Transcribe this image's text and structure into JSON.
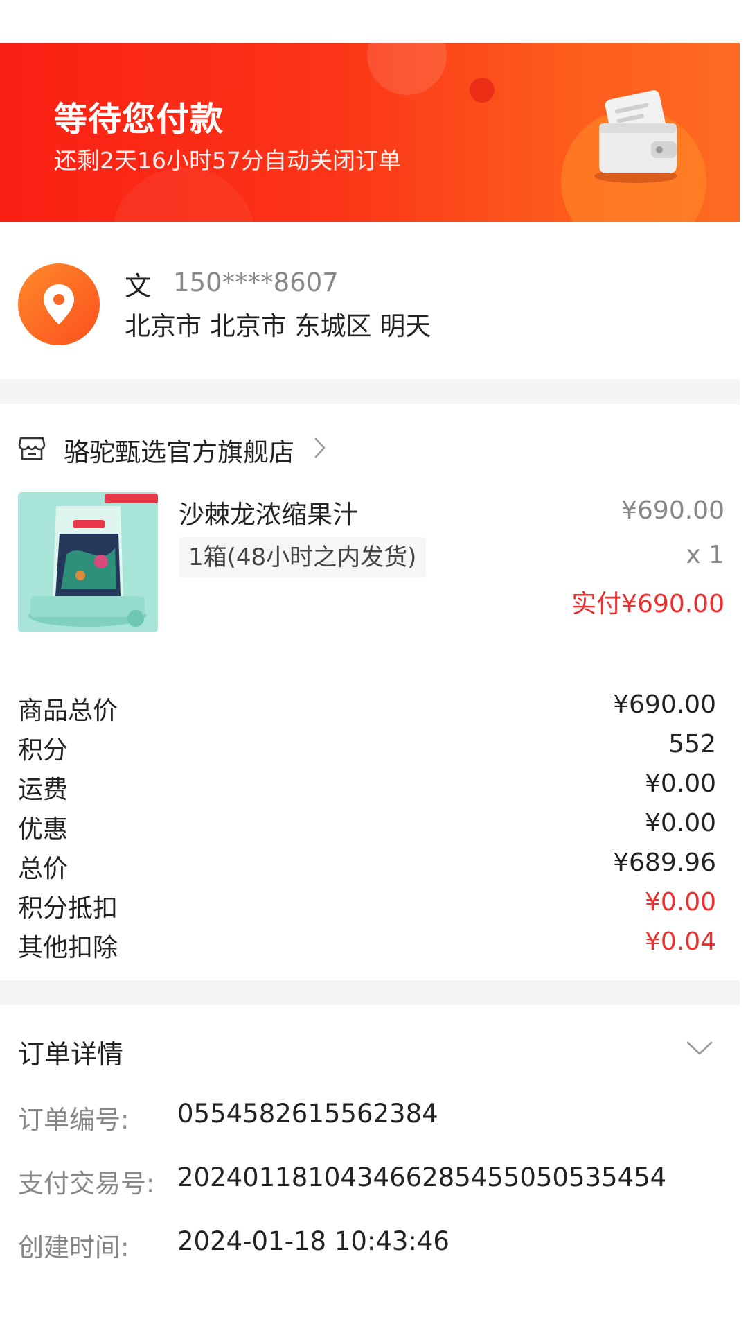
{
  "banner": {
    "title": "等待您付款",
    "subtitle": "还剩2天16小时57分自动关闭订单"
  },
  "address": {
    "name": "文",
    "phone": "150****8607",
    "line": "北京市 北京市 东城区 明天"
  },
  "shop": {
    "name": "骆驼甄选官方旗舰店"
  },
  "product": {
    "name": "沙棘龙浓缩果汁",
    "spec": "1箱(48小时之内发货)",
    "unit_price": "¥690.00",
    "quantity": "x 1",
    "paid": "实付¥690.00"
  },
  "summary": [
    {
      "label": "商品总价",
      "value": "¥690.00",
      "highlight": false
    },
    {
      "label": "积分",
      "value": "552",
      "highlight": false
    },
    {
      "label": "运费",
      "value": "¥0.00",
      "highlight": false
    },
    {
      "label": "优惠",
      "value": "¥0.00",
      "highlight": false
    },
    {
      "label": "总价",
      "value": "¥689.96",
      "highlight": false
    },
    {
      "label": "积分抵扣",
      "value": "¥0.00",
      "highlight": true
    },
    {
      "label": "其他扣除",
      "value": "¥0.04",
      "highlight": true
    }
  ],
  "order_detail": {
    "title": "订单详情",
    "rows": [
      {
        "label": "订单编号:",
        "value": "0554582615562384"
      },
      {
        "label": "支付交易号:",
        "value": "20240118104346628545505053545​4"
      },
      {
        "label": "创建时间:",
        "value": "2024-01-18 10:43:46"
      }
    ]
  },
  "colors": {
    "accent_red": "#f02d2d",
    "banner_start": "#fa2014",
    "banner_end": "#ff6b22"
  }
}
